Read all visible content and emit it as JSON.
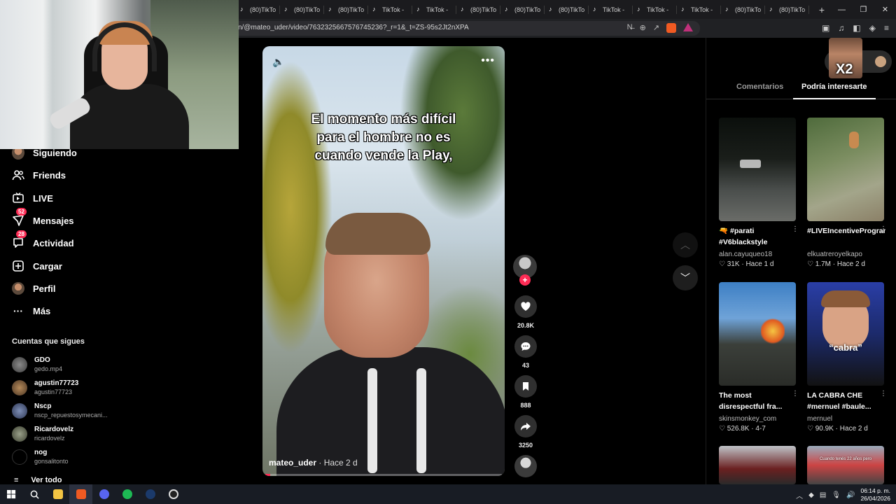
{
  "browser": {
    "tabs": [
      {
        "label": "(80)TikTo"
      },
      {
        "label": "(80)TikTo"
      },
      {
        "label": "(80)TikTo"
      },
      {
        "label": "TikTok -"
      },
      {
        "label": "TikTok -"
      },
      {
        "label": "(80)TikTo"
      },
      {
        "label": "(80)TikTo"
      },
      {
        "label": "(80)TikTo"
      },
      {
        "label": "TikTok -"
      },
      {
        "label": "TikTok -"
      },
      {
        "label": "TikTok -"
      },
      {
        "label": "(80)TikTo"
      },
      {
        "label": "(80)TikTo"
      }
    ],
    "new_tab": "+",
    "url": "n/@mateo_uder/video/7632325667576745236?_r=1&_t=ZS-95s2Jt2nXPA",
    "window_controls": {
      "minimize": "—",
      "restore": "❐",
      "close": "✕"
    }
  },
  "sidebar": {
    "items": [
      {
        "label": "Siguiendo",
        "icon": "following-avatar-icon"
      },
      {
        "label": "Friends",
        "icon": "friends-icon"
      },
      {
        "label": "LIVE",
        "icon": "live-icon"
      },
      {
        "label": "Mensajes",
        "icon": "messages-icon",
        "badge": "52"
      },
      {
        "label": "Actividad",
        "icon": "activity-icon",
        "badge": "28"
      },
      {
        "label": "Cargar",
        "icon": "upload-icon"
      },
      {
        "label": "Perfil",
        "icon": "profile-avatar-icon"
      },
      {
        "label": "Más",
        "icon": "more-icon"
      }
    ],
    "following_title": "Cuentas que sigues",
    "following": [
      {
        "name": "GDO",
        "handle": "gedo.mp4"
      },
      {
        "name": "agustin77723",
        "handle": "agustin77723"
      },
      {
        "name": "Nscp",
        "handle": "nscp_repuestosymecani..."
      },
      {
        "name": "Ricardovelz",
        "handle": "ricardovelz"
      },
      {
        "name": "nog",
        "handle": "gonsalitonto"
      }
    ],
    "see_all": "Ver todo"
  },
  "video": {
    "caption_lines": [
      "El momento más difícil",
      "para el hombre no es",
      "cuando vende la Play,"
    ],
    "author": "mateo_uder",
    "time": "· Hace 2 d",
    "progress": 0.02
  },
  "actions": {
    "likes": "20.8K",
    "comments": "43",
    "saves": "888",
    "shares": "3250"
  },
  "right_panel": {
    "tabs": [
      "Comentarios",
      "Podría interesarte"
    ],
    "active_tab": "Podría interesarte",
    "overlay_text": "X2",
    "cards": [
      {
        "title": "🔫 #parati #V6blackstyle",
        "user": "alan.cayuqueo18",
        "likes": "31K",
        "time": "Hace 1 d"
      },
      {
        "title": "#LIVEIncentiveProgram...",
        "user": "elkuatreroyelkapo",
        "likes": "1.7M",
        "time": "Hace 2 d"
      },
      {
        "title": "The most disrespectful fra...",
        "user": "skinsmonkey_com",
        "likes": "526.8K",
        "time": "4-7"
      },
      {
        "title": "LA CABRA CHE #mernuel #baule...",
        "user": "mernuel",
        "likes": "90.9K",
        "time": "Hace 2 d"
      }
    ],
    "thumb_overlay": "“cabra”",
    "thumb_bottom_right_text": "Cuando tenés 22 años pero"
  },
  "taskbar": {
    "time": "06:14 p. m.",
    "date": "26/04/2026"
  }
}
